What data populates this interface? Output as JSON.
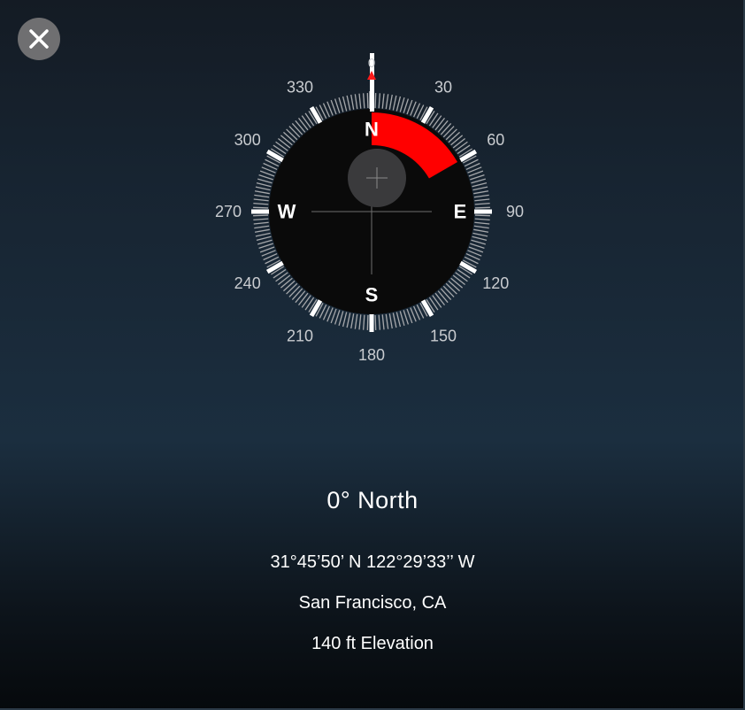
{
  "close_button": {
    "icon": "close-icon"
  },
  "compass": {
    "heading_deg": 0,
    "target_arc_deg": [
      0,
      60
    ],
    "colors": {
      "dial": "#0a0a0a",
      "target_arc": "#ff0000",
      "ticks": "#bfbfbf",
      "major_ticks": "#ffffff",
      "needle_tip": "#ff1a1a"
    },
    "cardinals": {
      "N": "N",
      "E": "E",
      "S": "S",
      "W": "W"
    },
    "pointer_label": "0",
    "degree_labels": [
      "30",
      "60",
      "90",
      "120",
      "150",
      "180",
      "210",
      "240",
      "270",
      "300",
      "330"
    ]
  },
  "readout": {
    "heading": "0° North",
    "coordinates": "31°45’50’ N 122°29’33’’ W",
    "location": "San Francisco, CA",
    "elevation": "140 ft Elevation"
  }
}
